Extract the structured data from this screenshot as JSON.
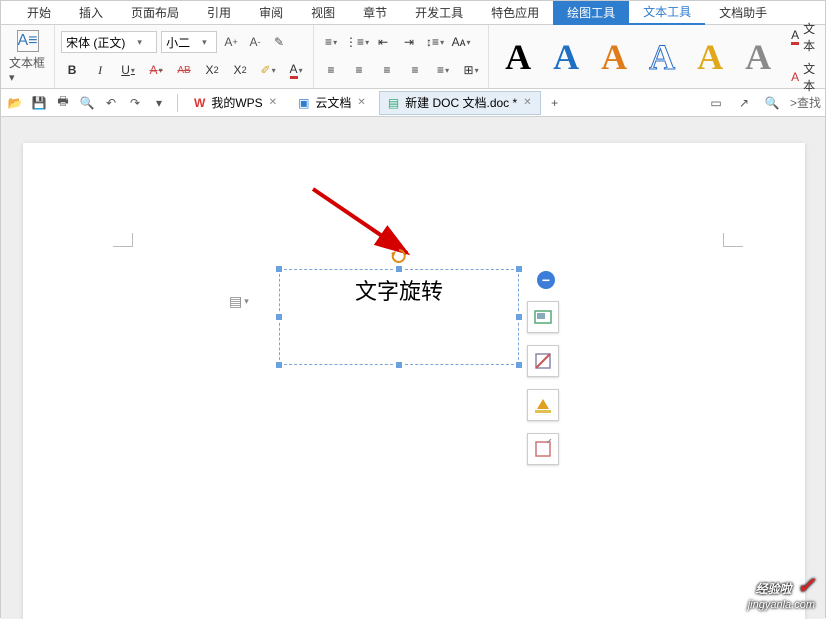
{
  "menu": {
    "tabs": [
      "开始",
      "插入",
      "页面布局",
      "引用",
      "审阅",
      "视图",
      "章节",
      "开发工具",
      "特色应用",
      "绘图工具",
      "文本工具",
      "文档助手"
    ],
    "active_index": 9,
    "active2_index": 10
  },
  "ribbon": {
    "textbox_label": "文本框",
    "font_name": "宋体 (正文)",
    "font_size": "小二",
    "increase": "A⁺",
    "decrease": "A⁻",
    "clear": "✎",
    "bold": "B",
    "italic": "I",
    "underline": "U",
    "strike": "A",
    "strike2": "AB",
    "super": "X²",
    "sub": "X₂",
    "highlight": "✐",
    "fontcolor": "A",
    "bullets": "≡",
    "numbering": "⋮≡",
    "indent_dec": "⇤",
    "indent_inc": "⇥",
    "lineheight": "↕≡",
    "aa": "Aᴀ",
    "align_l": "≡",
    "align_c": "≡",
    "align_r": "≡",
    "align_j": "≡",
    "dist": "≡",
    "borders": "⊞",
    "end_text1": "文本",
    "end_text2": "文本"
  },
  "big_a_colors": [
    "#000000",
    "#1f6fc4",
    "#e07b1a",
    "#2a6dc7",
    "#e0a81a",
    "#8a8a8a"
  ],
  "qat": {
    "icons": [
      "open",
      "save",
      "print",
      "preview",
      "undo",
      "redo",
      "dropdown"
    ],
    "tabs": [
      {
        "icon": "wps",
        "label": "我的WPS"
      },
      {
        "icon": "cloud",
        "label": "云文档"
      },
      {
        "icon": "doc",
        "label": "新建 DOC 文档.doc *",
        "current": true
      }
    ],
    "add": "+",
    "search": ">查找"
  },
  "document": {
    "textbox_text": "文字旋转"
  },
  "float_opts": {
    "minus": "−"
  },
  "watermark": {
    "line1": "经验啦",
    "check": "✓",
    "line2": "jingyanla.com"
  },
  "chart_data": null
}
